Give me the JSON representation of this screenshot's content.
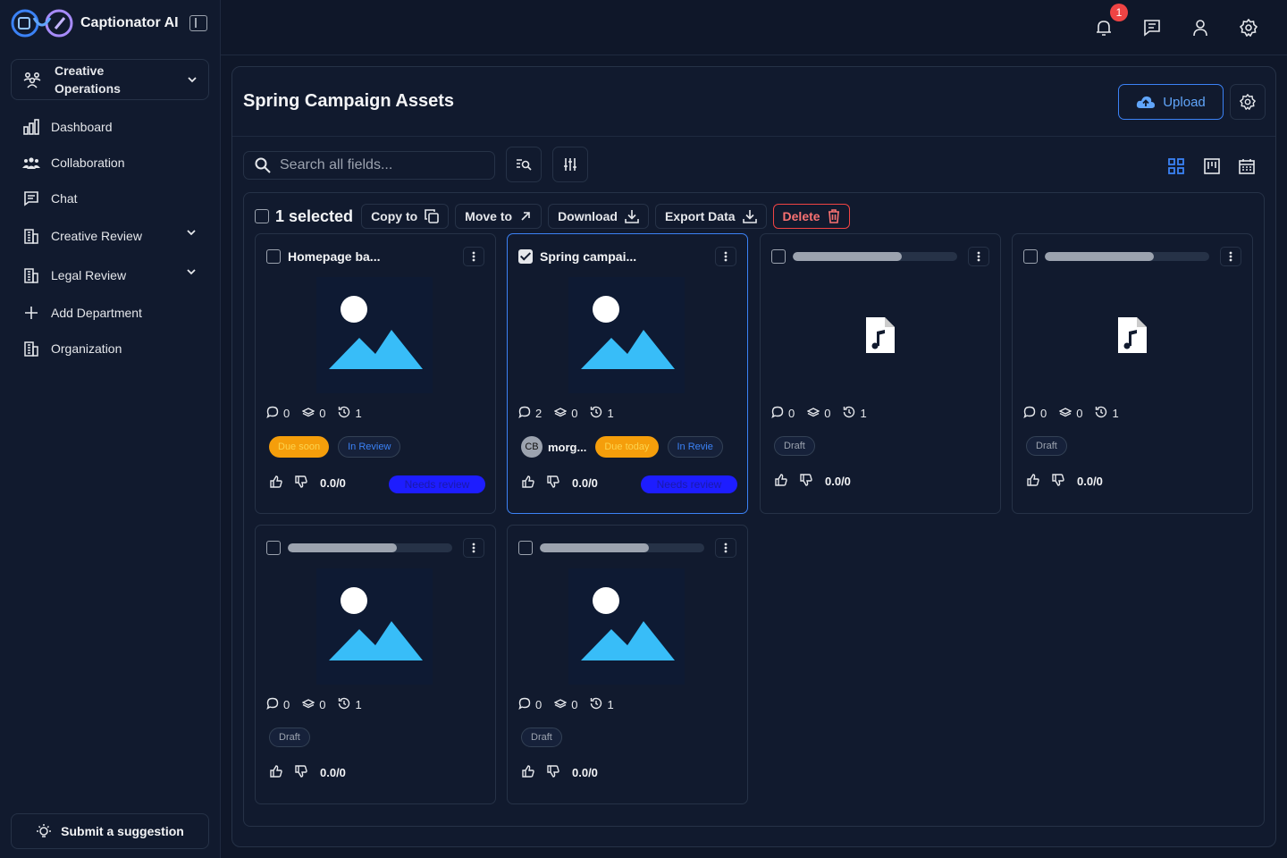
{
  "app": {
    "name": "Captionator AI"
  },
  "sidebar": {
    "department": "Creative Operations",
    "items": [
      {
        "label": "Dashboard",
        "icon": "chart-bar-icon"
      },
      {
        "label": "Collaboration",
        "icon": "users-icon"
      },
      {
        "label": "Chat",
        "icon": "chat-icon"
      },
      {
        "label": "Creative Review",
        "icon": "building-icon",
        "expandable": true
      },
      {
        "label": "Legal Review",
        "icon": "building-icon",
        "expandable": true
      },
      {
        "label": "Add Department",
        "icon": "plus-icon"
      },
      {
        "label": "Organization",
        "icon": "building-icon"
      }
    ],
    "suggest_label": "Submit a suggestion"
  },
  "topbar": {
    "notification_count": "1"
  },
  "main": {
    "title": "Spring Campaign Assets",
    "upload_label": "Upload",
    "search_placeholder": "Search all fields...",
    "bulk": {
      "selected": "1 selected",
      "copy": "Copy to",
      "move": "Move to",
      "download": "Download",
      "export": "Export Data",
      "delete": "Delete"
    },
    "cards": [
      {
        "title": "Homepage ba...",
        "checked": false,
        "type": "image",
        "comments": "0",
        "layers": "0",
        "versions": "1",
        "due": "Due soon",
        "status": "In Review",
        "rating": "0.0/0",
        "needs": "Needs review"
      },
      {
        "title": "Spring campai...",
        "checked": true,
        "type": "image",
        "comments": "2",
        "layers": "0",
        "versions": "1",
        "assignee_initials": "CB",
        "assignee": "morg...",
        "due": "Due today",
        "status": "In Revie",
        "rating": "0.0/0",
        "needs": "Needs review"
      },
      {
        "title": "",
        "checked": false,
        "type": "audio",
        "comments": "0",
        "layers": "0",
        "versions": "1",
        "status": "Draft",
        "rating": "0.0/0"
      },
      {
        "title": "",
        "checked": false,
        "type": "audio",
        "comments": "0",
        "layers": "0",
        "versions": "1",
        "status": "Draft",
        "rating": "0.0/0"
      },
      {
        "title": "",
        "checked": false,
        "type": "image",
        "comments": "0",
        "layers": "0",
        "versions": "1",
        "status": "Draft",
        "rating": "0.0/0"
      },
      {
        "title": "",
        "checked": false,
        "type": "image",
        "comments": "0",
        "layers": "0",
        "versions": "1",
        "status": "Draft",
        "rating": "0.0/0"
      }
    ]
  },
  "colors": {
    "accent": "#3b82f6",
    "danger": "#ef4444",
    "warning": "#f59e0b",
    "background": "#0f1729"
  }
}
